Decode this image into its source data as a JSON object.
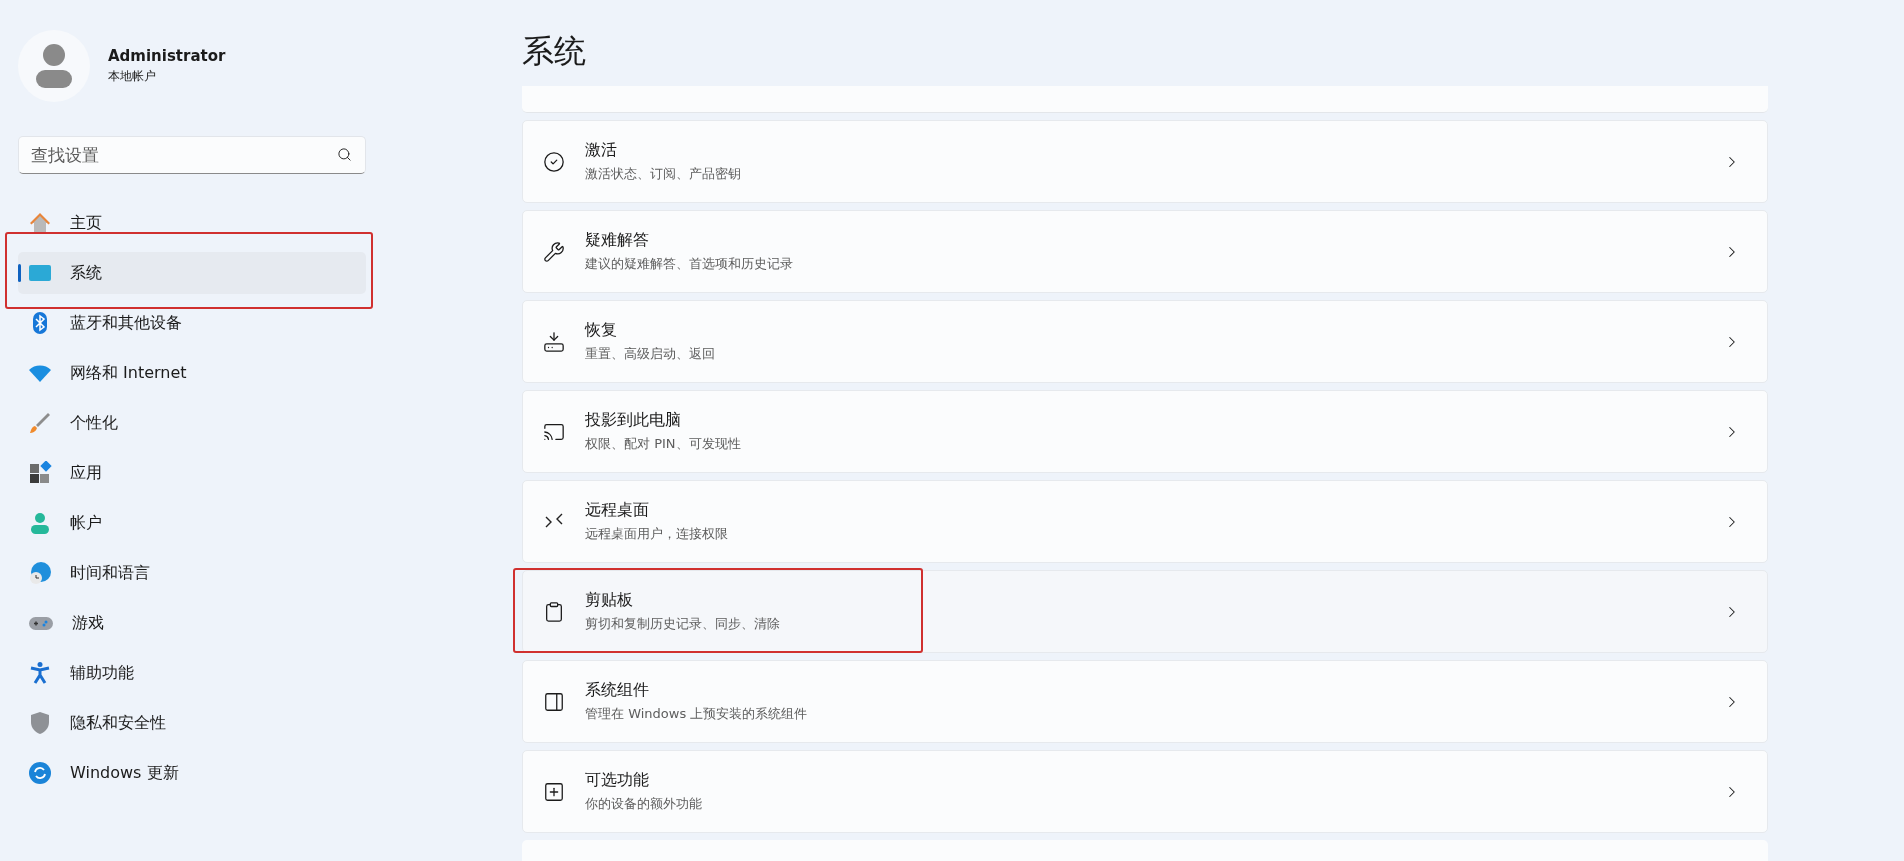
{
  "user": {
    "name": "Administrator",
    "account_type": "本地帐户"
  },
  "search": {
    "placeholder": "查找设置"
  },
  "nav": [
    {
      "label": "主页",
      "selected": false,
      "annotated": false
    },
    {
      "label": "系统",
      "selected": true,
      "annotated": true
    },
    {
      "label": "蓝牙和其他设备",
      "selected": false,
      "annotated": false
    },
    {
      "label": "网络和 Internet",
      "selected": false,
      "annotated": false
    },
    {
      "label": "个性化",
      "selected": false,
      "annotated": false
    },
    {
      "label": "应用",
      "selected": false,
      "annotated": false
    },
    {
      "label": "帐户",
      "selected": false,
      "annotated": false
    },
    {
      "label": "时间和语言",
      "selected": false,
      "annotated": false
    },
    {
      "label": "游戏",
      "selected": false,
      "annotated": false
    },
    {
      "label": "辅助功能",
      "selected": false,
      "annotated": false
    },
    {
      "label": "隐私和安全性",
      "selected": false,
      "annotated": false
    },
    {
      "label": "Windows 更新",
      "selected": false,
      "annotated": false
    }
  ],
  "page_title": "系统",
  "cards": [
    {
      "title": "激活",
      "subtitle": "激活状态、订阅、产品密钥",
      "hovered": false,
      "annotated": false
    },
    {
      "title": "疑难解答",
      "subtitle": "建议的疑难解答、首选项和历史记录",
      "hovered": false,
      "annotated": false
    },
    {
      "title": "恢复",
      "subtitle": "重置、高级启动、返回",
      "hovered": false,
      "annotated": false
    },
    {
      "title": "投影到此电脑",
      "subtitle": "权限、配对 PIN、可发现性",
      "hovered": false,
      "annotated": false
    },
    {
      "title": "远程桌面",
      "subtitle": "远程桌面用户，连接权限",
      "hovered": false,
      "annotated": false
    },
    {
      "title": "剪贴板",
      "subtitle": "剪切和复制历史记录、同步、清除",
      "hovered": true,
      "annotated": true
    },
    {
      "title": "系统组件",
      "subtitle": "管理在 Windows 上预安装的系统组件",
      "hovered": false,
      "annotated": false
    },
    {
      "title": "可选功能",
      "subtitle": "你的设备的额外功能",
      "hovered": false,
      "annotated": false
    }
  ]
}
